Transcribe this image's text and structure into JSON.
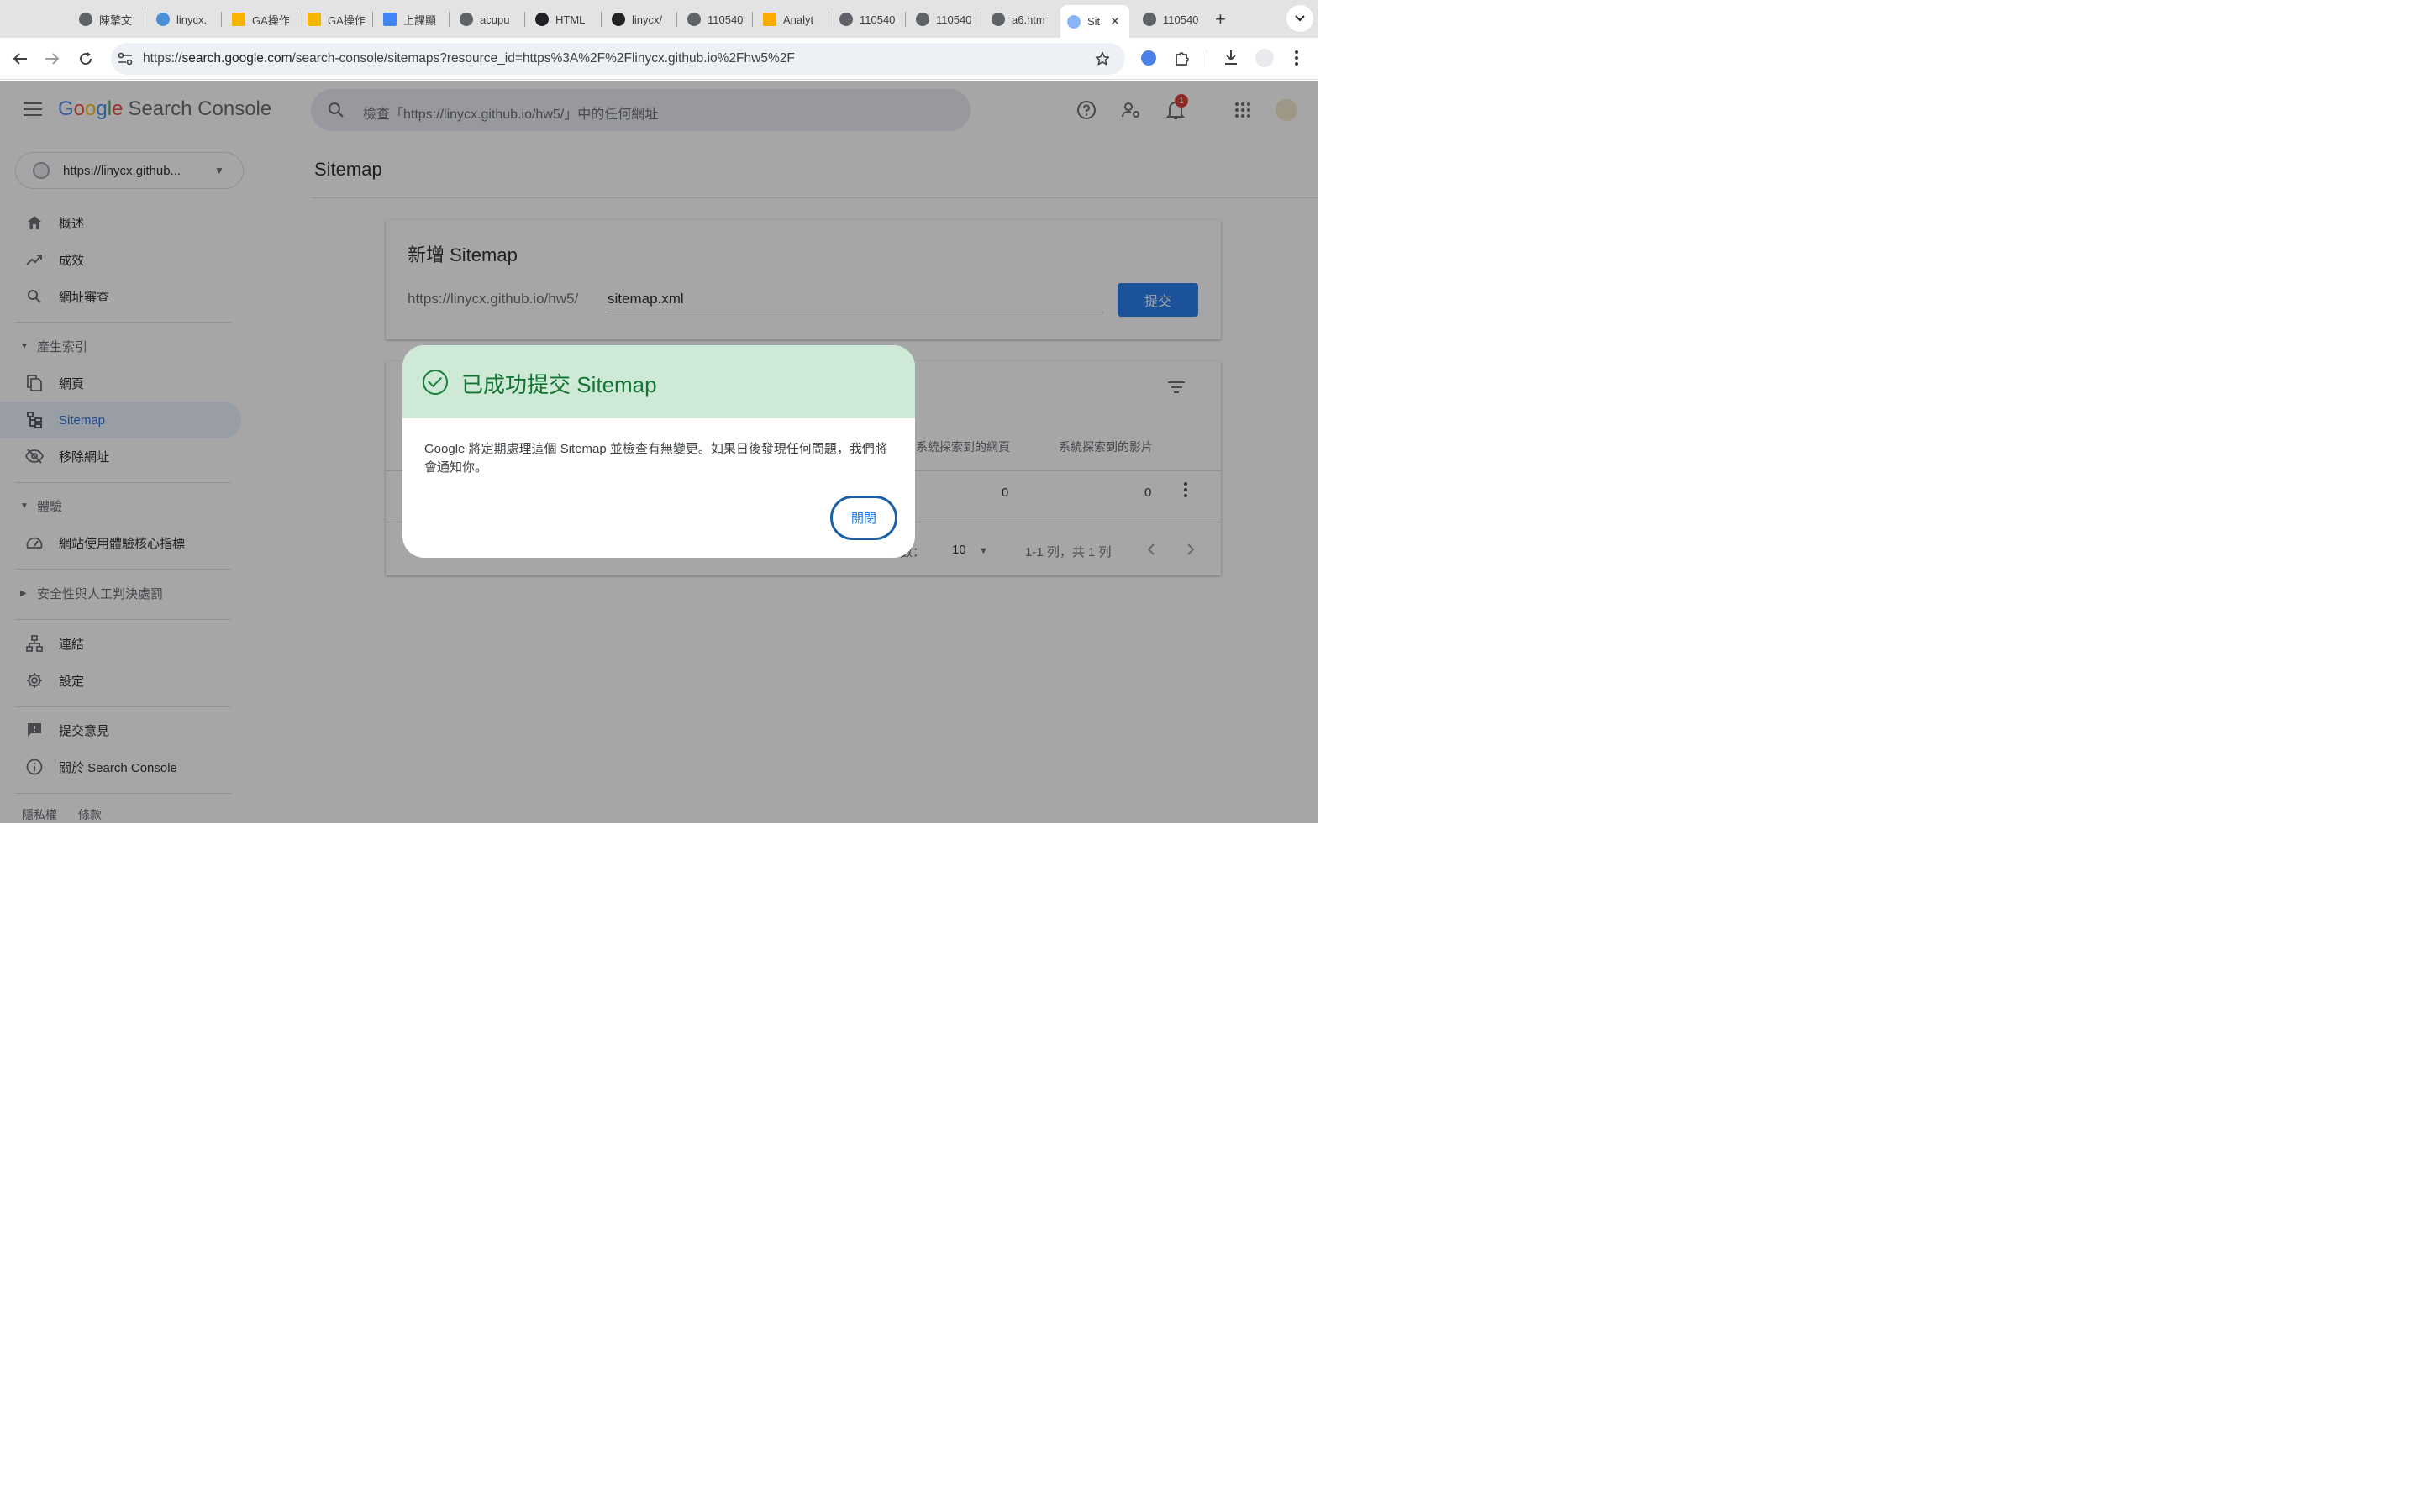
{
  "browser": {
    "tabs": [
      {
        "title": "陳擎文",
        "icon": "globe-icon"
      },
      {
        "title": "linycx.",
        "icon": "globe-icon"
      },
      {
        "title": "GA操作",
        "icon": "slides-icon"
      },
      {
        "title": "GA操作",
        "icon": "slides-icon"
      },
      {
        "title": "上課顯",
        "icon": "docs-icon"
      },
      {
        "title": "acupu",
        "icon": "globe-icon"
      },
      {
        "title": "HTML",
        "icon": "openai-icon"
      },
      {
        "title": "linycx/",
        "icon": "github-icon"
      },
      {
        "title": "110540",
        "icon": "globe-icon"
      },
      {
        "title": "Analyt",
        "icon": "analytics-icon"
      },
      {
        "title": "110540",
        "icon": "globe-icon"
      },
      {
        "title": "110540",
        "icon": "globe-icon"
      },
      {
        "title": "a6.htm",
        "icon": "globe-icon"
      },
      {
        "title": "Sit",
        "icon": "search-console-icon",
        "active": true
      },
      {
        "title": "110540",
        "icon": "globe-icon"
      }
    ],
    "url_prefix": "https://",
    "url_host": "search.google.com",
    "url_path": "/search-console/sitemaps?resource_id=https%3A%2F%2Flinycx.github.io%2Fhw5%2F"
  },
  "header": {
    "logo_google": "Google",
    "logo_product": "Search Console",
    "search_placeholder": "檢查「https://linycx.github.io/hw5/」中的任何網址",
    "notification_count": "1"
  },
  "sidebar": {
    "property": "https://linycx.github...",
    "items": [
      {
        "label": "概述"
      },
      {
        "label": "成效"
      },
      {
        "label": "網址審查"
      }
    ],
    "section_indexing": "產生索引",
    "indexing_items": [
      {
        "label": "網頁"
      },
      {
        "label": "Sitemap"
      },
      {
        "label": "移除網址"
      }
    ],
    "section_experience": "體驗",
    "experience_items": [
      {
        "label": "網站使用體驗核心指標"
      }
    ],
    "section_security": "安全性與人工判決處罰",
    "other_items": [
      {
        "label": "連結"
      },
      {
        "label": "設定"
      }
    ],
    "footer_items": [
      {
        "label": "提交意見"
      },
      {
        "label": "關於 Search Console"
      }
    ],
    "privacy": "隱私權",
    "terms": "條款"
  },
  "main": {
    "page_title": "Sitemap",
    "add_card": {
      "title": "新增 Sitemap",
      "url_prefix": "https://linycx.github.io/hw5/",
      "input_value": "sitemap.xml",
      "submit_label": "提交"
    },
    "table": {
      "columns": [
        "系統探索到的網頁",
        "系統探索到的影片"
      ],
      "row": {
        "pages": "0",
        "videos": "0"
      },
      "rows_per_page_label": "數：",
      "rows_per_page": "10",
      "range": "1-1 列，共 1 列"
    }
  },
  "dialog": {
    "title": "已成功提交 Sitemap",
    "body": "Google 將定期處理這個 Sitemap 並檢查有無變更。如果日後發現任何問題，我們將會通知你。",
    "close_label": "關閉"
  },
  "colors": {
    "accent": "#1a73e8",
    "success_bg": "#ceead6",
    "success_text": "#137333"
  }
}
